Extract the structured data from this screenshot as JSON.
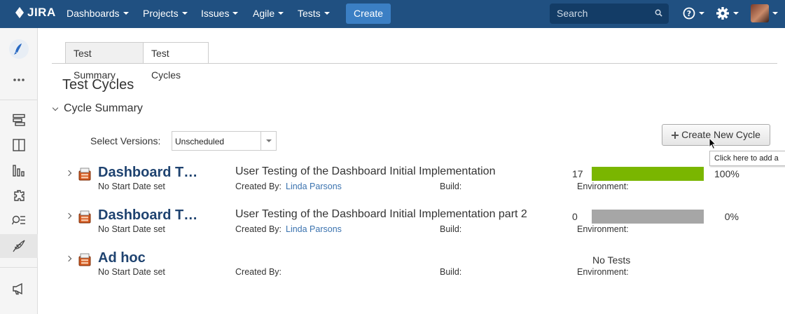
{
  "nav": {
    "logo": "JIRA",
    "items": [
      "Dashboards",
      "Projects",
      "Issues",
      "Agile",
      "Tests"
    ],
    "create_label": "Create",
    "search_placeholder": "Search"
  },
  "sidebar": {
    "icons": [
      "rocket-icon",
      "more-icon",
      "backlog-icon",
      "board-icon",
      "reports-icon",
      "addons-icon",
      "search-tests-icon",
      "test-feather-icon",
      "announcement-icon"
    ]
  },
  "tabs": [
    {
      "label": "Test Summary",
      "active": false
    },
    {
      "label": "Test Cycles",
      "active": true
    }
  ],
  "page": {
    "title": "Test Cycles",
    "section": "Cycle Summary",
    "select_label": "Select Versions:",
    "select_value": "Unscheduled",
    "new_cycle_label": "Create New Cycle",
    "tooltip": "Click here to add a"
  },
  "cycles": [
    {
      "name": "Dashboard T…",
      "dates": "No Start Date set",
      "description": "User Testing of the Dashboard Initial Implementation",
      "created_by_label": "Created By:",
      "created_by": "Linda Parsons",
      "build_label": "Build:",
      "env_label": "Environment:",
      "count": "17",
      "percent": "100%",
      "progress": 1.0,
      "bar_color": "#7ab600",
      "no_tests": ""
    },
    {
      "name": "Dashboard T…",
      "dates": "No Start Date set",
      "description": "User Testing of the Dashboard Initial Implementation part 2",
      "created_by_label": "Created By:",
      "created_by": "Linda Parsons",
      "build_label": "Build:",
      "env_label": "Environment:",
      "count": "0",
      "percent": "0%",
      "progress": 0.0,
      "bar_color": "#a6a6a6",
      "no_tests": ""
    },
    {
      "name": "Ad hoc",
      "dates": "No Start Date set",
      "description": "",
      "created_by_label": "Created By:",
      "created_by": "",
      "build_label": "Build:",
      "env_label": "Environment:",
      "count": "",
      "percent": "",
      "progress": null,
      "bar_color": "",
      "no_tests": "No Tests"
    }
  ],
  "colors": {
    "nav_bg": "#205081",
    "link": "#3b73af",
    "cycle_name": "#1f4370"
  }
}
